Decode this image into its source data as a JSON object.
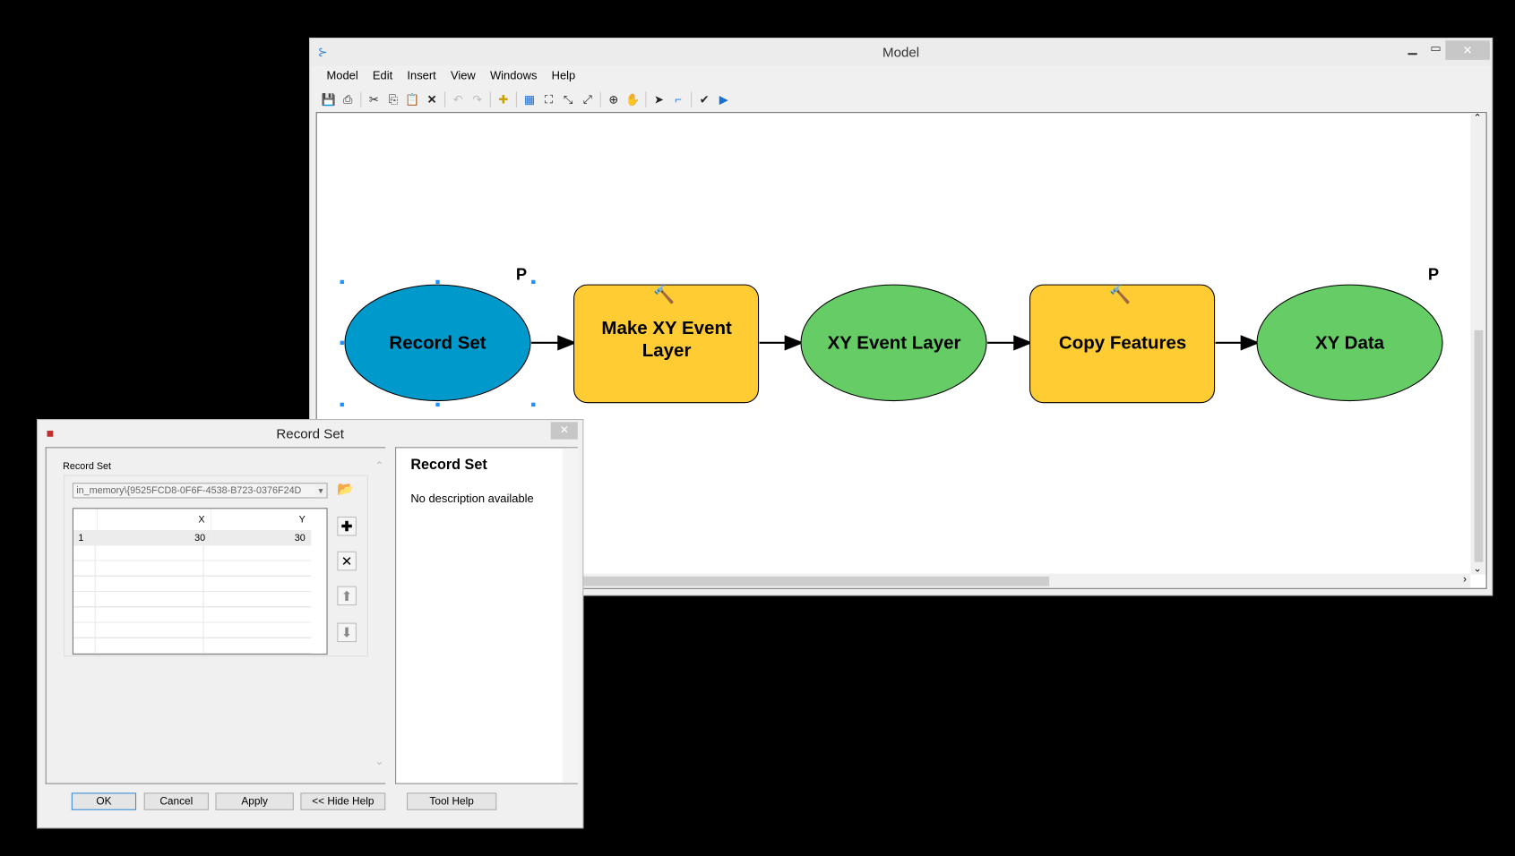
{
  "model_window": {
    "title": "Model",
    "menu": [
      "Model",
      "Edit",
      "Insert",
      "View",
      "Windows",
      "Help"
    ],
    "toolbar_icons": [
      "save-icon",
      "print-icon",
      "cut-icon",
      "copy-icon",
      "paste-icon",
      "delete-icon",
      "undo-icon",
      "redo-icon",
      "add-data-icon",
      "auto-layout-icon",
      "full-extent-icon",
      "zoom-in-fixed-icon",
      "zoom-out-fixed-icon",
      "zoom-in-icon",
      "pan-icon",
      "select-icon",
      "connect-icon",
      "validate-icon",
      "run-icon"
    ],
    "nodes": [
      {
        "label": "Record Set",
        "type": "input-variable",
        "color": "#0099cc",
        "parameter": "P"
      },
      {
        "label": "Make XY Event Layer",
        "type": "tool",
        "color": "#ffcc33"
      },
      {
        "label": "XY Event Layer",
        "type": "derived-data",
        "color": "#66cc66"
      },
      {
        "label": "Copy Features",
        "type": "tool",
        "color": "#ffcc33"
      },
      {
        "label": "XY Data",
        "type": "output-data",
        "color": "#66cc66",
        "parameter": "P"
      }
    ]
  },
  "dialog": {
    "title": "Record Set",
    "param_label": "Record Set",
    "combo_value": "in_memory\\{9525FCD8-0F6F-4538-B723-0376F24D",
    "columns": [
      "",
      "X",
      "Y"
    ],
    "rows": [
      [
        "1",
        "30",
        "30"
      ]
    ],
    "help_title": "Record Set",
    "help_text": "No description available",
    "buttons": {
      "ok": "OK",
      "cancel": "Cancel",
      "apply": "Apply",
      "hide_help": "<< Hide Help",
      "tool_help": "Tool Help"
    }
  }
}
